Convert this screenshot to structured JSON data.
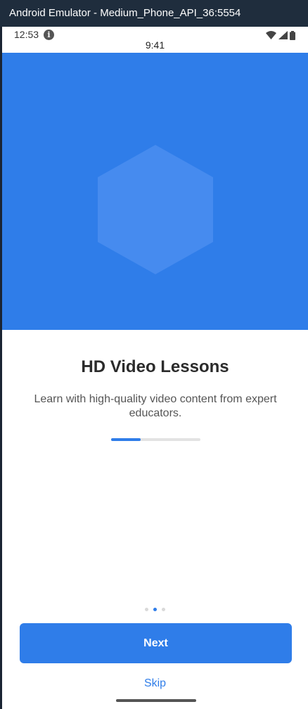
{
  "window": {
    "title": "Android Emulator - Medium_Phone_API_36:5554"
  },
  "status_bar": {
    "time": "12:53",
    "info_icon": "info-icon",
    "icons": [
      "wifi-icon",
      "signal-icon",
      "battery-icon"
    ]
  },
  "app": {
    "clock": "9:41"
  },
  "hero": {
    "background": "#2f7de9",
    "shape": "hexagon"
  },
  "content": {
    "title": "HD Video Lessons",
    "description": "Learn with high-quality video content from expert educators.",
    "progress": 0.33
  },
  "pager": {
    "count": 3,
    "active_index": 1
  },
  "actions": {
    "next_label": "Next",
    "skip_label": "Skip"
  },
  "colors": {
    "accent": "#2f7de9",
    "text_primary": "#2b2b2b",
    "text_secondary": "#555555"
  }
}
